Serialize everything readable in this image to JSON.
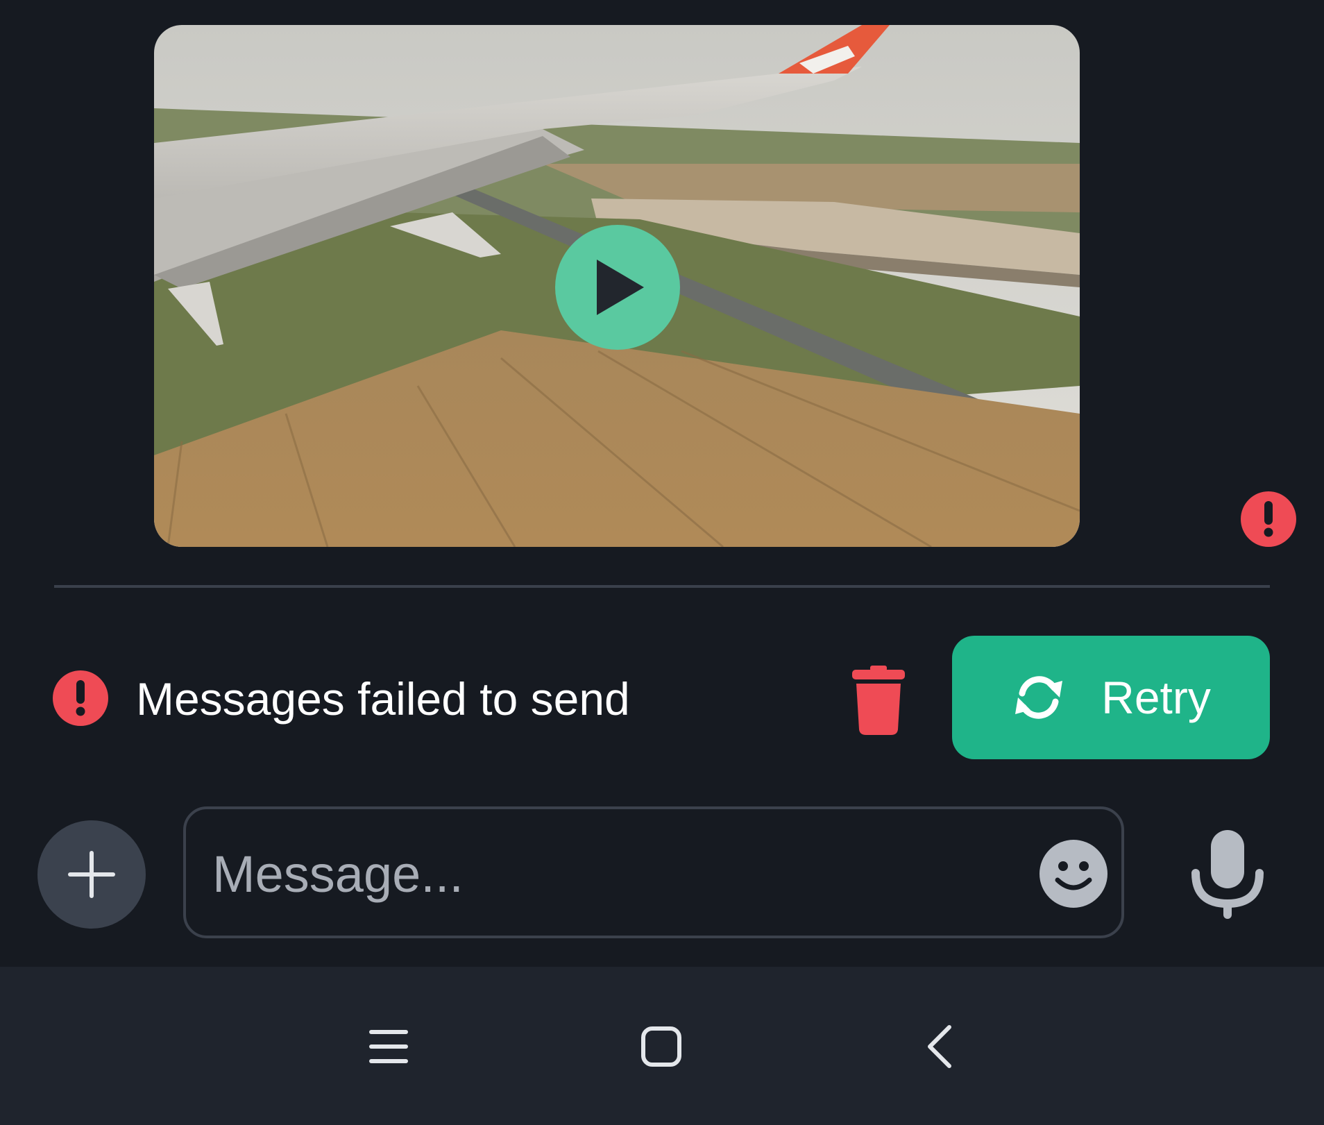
{
  "video_message": {
    "thumbnail_subject": "airplane wing over fields",
    "play_icon": "play-icon",
    "status_icon": "exclamation-icon"
  },
  "failed_banner": {
    "text": "Messages failed to send",
    "status_icon": "exclamation-icon",
    "delete_icon": "trash-icon",
    "retry_label": "Retry",
    "retry_icon": "refresh-icon"
  },
  "composer": {
    "add_icon": "plus-icon",
    "placeholder": "Message...",
    "value": "",
    "emoji_icon": "smiley-icon",
    "mic_icon": "microphone-icon"
  },
  "nav_bar": {
    "recents_icon": "menu-lines-icon",
    "home_icon": "home-square-icon",
    "back_icon": "chevron-left-icon"
  },
  "colors": {
    "background": "#161a21",
    "accent": "#1fb489",
    "play": "#5ac9a0",
    "error": "#ef4b55",
    "nav_background": "#1f242d"
  }
}
